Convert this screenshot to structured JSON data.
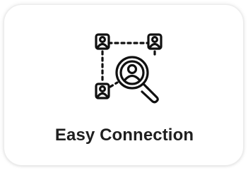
{
  "card": {
    "title": "Easy Connection",
    "icon": "network-search-icon"
  },
  "colors": {
    "icon": "#111111",
    "text": "#1f1f1f",
    "background": "#ffffff"
  }
}
